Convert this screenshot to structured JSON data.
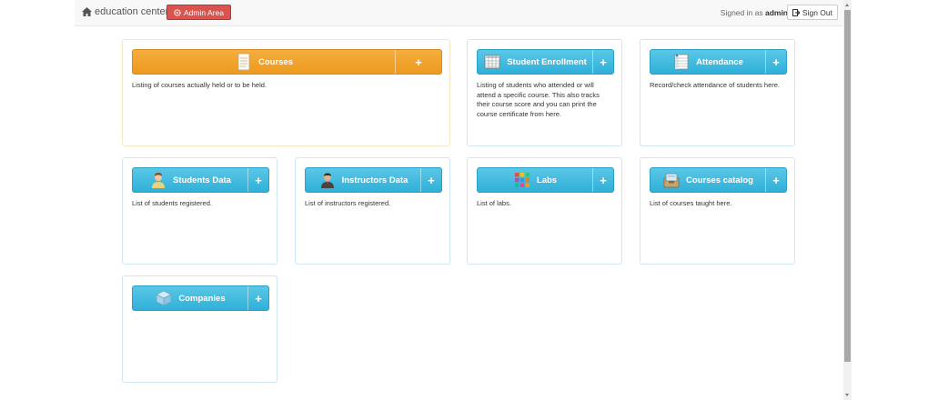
{
  "navbar": {
    "brand": "education center",
    "admin_label": "Admin Area",
    "signed_prefix": "Signed in as",
    "signed_user": "admin",
    "signout_label": "Sign Out"
  },
  "tiles": [
    {
      "label": "Courses",
      "plus": "+",
      "icon": "notepad-icon",
      "desc": "Listing of courses actually held or to be held."
    },
    {
      "label": "Student Enrollment",
      "plus": "+",
      "icon": "grid-table-icon",
      "desc": "Listing of students who attended or will attend a specific course. This also tracks their course score and you can print the course certificate from here."
    },
    {
      "label": "Attendance",
      "plus": "+",
      "icon": "checklist-icon",
      "desc": "Record/check attendance of students here."
    },
    {
      "label": "Students Data",
      "plus": "+",
      "icon": "student-icon",
      "desc": "List of students registered."
    },
    {
      "label": "Instructors Data",
      "plus": "+",
      "icon": "instructor-icon",
      "desc": "List of instructors registered."
    },
    {
      "label": "Labs",
      "plus": "+",
      "icon": "color-blocks-icon",
      "desc": "List of labs."
    },
    {
      "label": "Courses catalog",
      "plus": "+",
      "icon": "catalog-box-icon",
      "desc": "List of courses taught here."
    },
    {
      "label": "Companies",
      "plus": "+",
      "icon": "cube-icon",
      "desc": ""
    }
  ]
}
